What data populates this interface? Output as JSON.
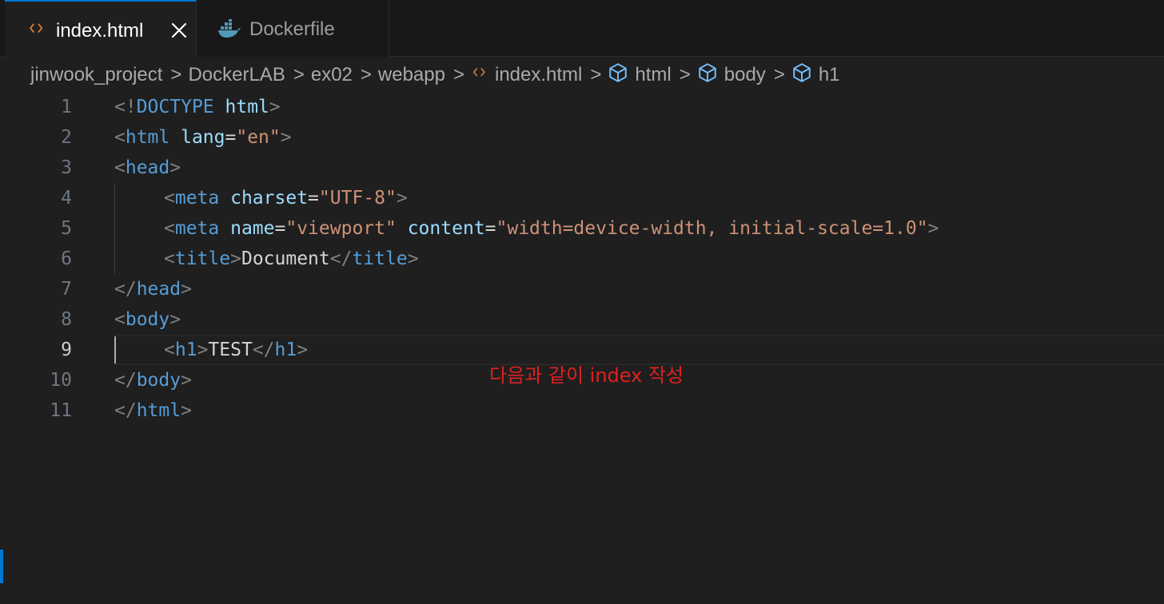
{
  "tabs": [
    {
      "label": "index.html",
      "active": true,
      "icon": "html-code-icon"
    },
    {
      "label": "Dockerfile",
      "active": false,
      "icon": "docker-icon"
    }
  ],
  "breadcrumb": {
    "items": [
      "jinwook_project",
      "DockerLAB",
      "ex02",
      "webapp",
      "index.html",
      "html",
      "body",
      "h1"
    ],
    "separator": ">"
  },
  "lines": {
    "numbers": [
      "1",
      "2",
      "3",
      "4",
      "5",
      "6",
      "7",
      "8",
      "9",
      "10",
      "11"
    ],
    "current": "9"
  },
  "code": {
    "l1": {
      "a": "<!",
      "b": "DOCTYPE",
      "c": " ",
      "d": "html",
      "e": ">"
    },
    "l2": {
      "a": "<",
      "b": "html",
      "c": " ",
      "d": "lang",
      "e": "=",
      "f": "\"en\"",
      "g": ">"
    },
    "l3": {
      "a": "<",
      "b": "head",
      "c": ">"
    },
    "l4": {
      "a": "<",
      "b": "meta",
      "c": " ",
      "d": "charset",
      "e": "=",
      "f": "\"UTF-8\"",
      "g": ">"
    },
    "l5": {
      "a": "<",
      "b": "meta",
      "c": " ",
      "d": "name",
      "e": "=",
      "f": "\"viewport\"",
      "g": " ",
      "h": "content",
      "i": "=",
      "j": "\"width=device-width, initial-scale=1.0\"",
      "k": ">"
    },
    "l6": {
      "a": "<",
      "b": "title",
      "c": ">",
      "d": "Document",
      "e": "</",
      "f": "title",
      "g": ">"
    },
    "l7": {
      "a": "</",
      "b": "head",
      "c": ">"
    },
    "l8": {
      "a": "<",
      "b": "body",
      "c": ">"
    },
    "l9": {
      "a": "<",
      "b": "h1",
      "c": ">",
      "d": "TEST",
      "e": "</",
      "f": "h1",
      "g": ">"
    },
    "l10": {
      "a": "</",
      "b": "body",
      "c": ">"
    },
    "l11": {
      "a": "</",
      "b": "html",
      "c": ">"
    }
  },
  "annotation": "다음과 같이 index 작성",
  "colors": {
    "accent": "#0078d4",
    "tag": "#569cd6",
    "attribute": "#9cdcfe",
    "string": "#ce9178",
    "annotation": "#e02020",
    "html_icon": "#e37933",
    "docker_icon": "#519aba"
  }
}
